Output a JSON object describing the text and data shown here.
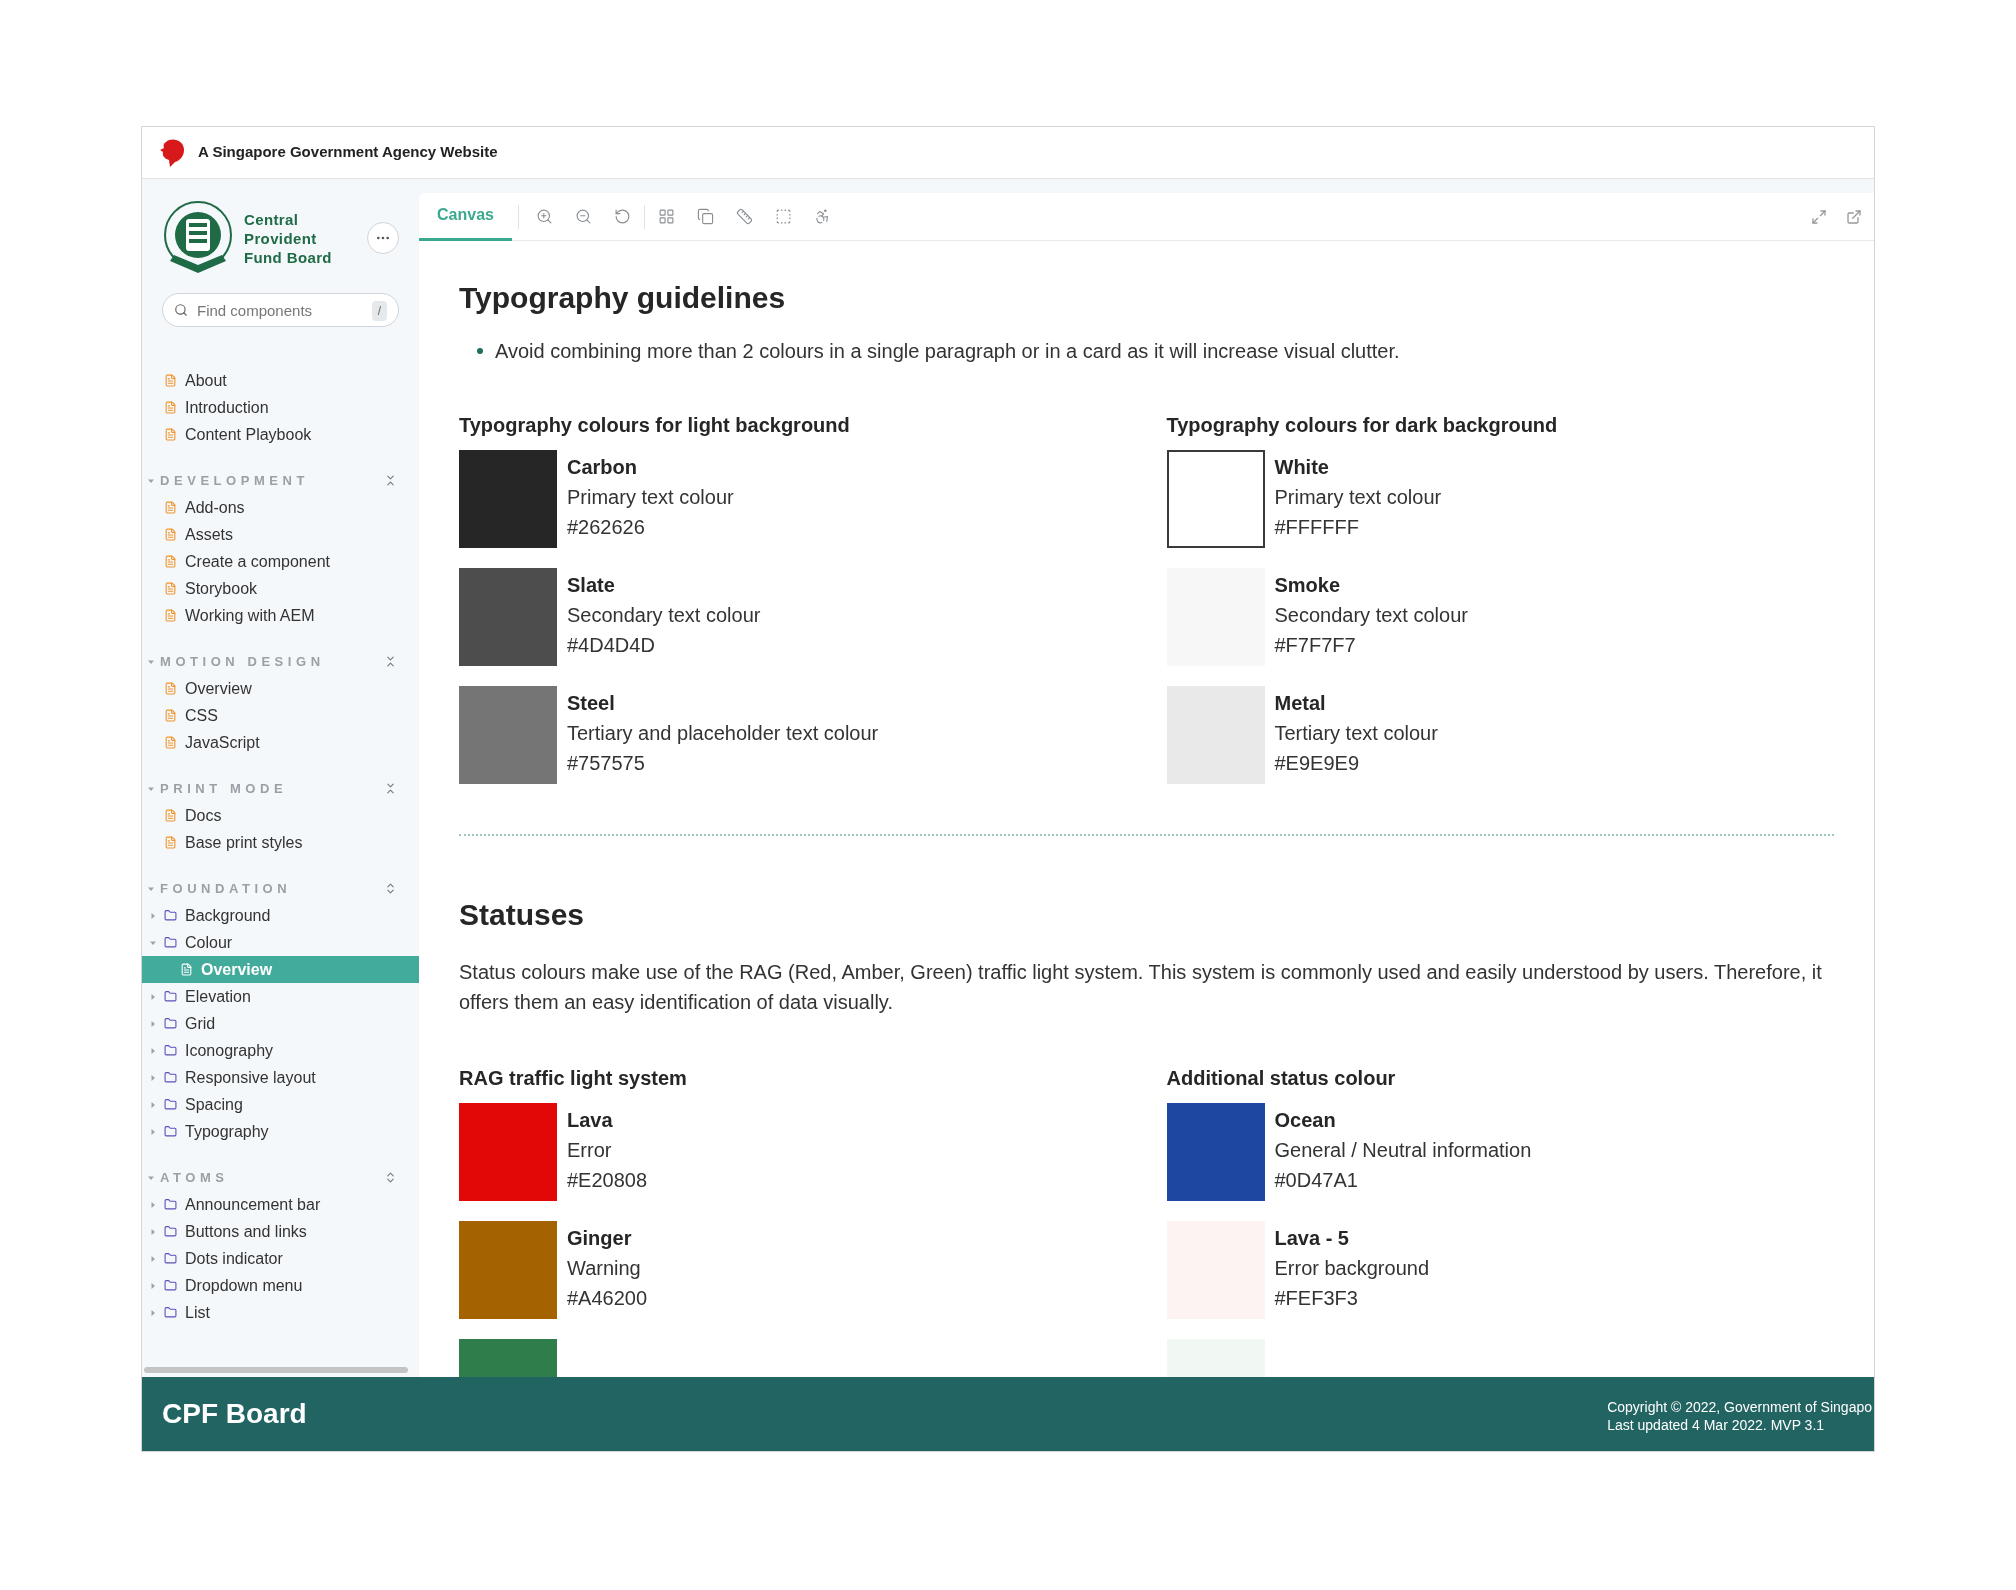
{
  "masthead": {
    "text": "A Singapore Government Agency Website"
  },
  "sidebar": {
    "logo_text": [
      "Central",
      "Provident",
      "Fund Board"
    ],
    "search": {
      "placeholder": "Find components",
      "shortcut": "/"
    },
    "top_items": [
      {
        "label": "About",
        "kind": "page",
        "selected": false
      },
      {
        "label": "Introduction",
        "kind": "page",
        "selected": false
      },
      {
        "label": "Content Playbook",
        "kind": "page",
        "selected": false
      }
    ],
    "sections": [
      {
        "title": "DEVELOPMENT",
        "all_expanded": true,
        "items": [
          {
            "label": "Add-ons",
            "kind": "page",
            "selected": false
          },
          {
            "label": "Assets",
            "kind": "page",
            "selected": false
          },
          {
            "label": "Create a component",
            "kind": "page",
            "selected": false
          },
          {
            "label": "Storybook",
            "kind": "page",
            "selected": false
          },
          {
            "label": "Working with AEM",
            "kind": "page",
            "selected": false
          }
        ]
      },
      {
        "title": "MOTION DESIGN",
        "all_expanded": true,
        "items": [
          {
            "label": "Overview",
            "kind": "page",
            "selected": false
          },
          {
            "label": "CSS",
            "kind": "page",
            "selected": false
          },
          {
            "label": "JavaScript",
            "kind": "page",
            "selected": false
          }
        ]
      },
      {
        "title": "PRINT MODE",
        "all_expanded": true,
        "items": [
          {
            "label": "Docs",
            "kind": "page",
            "selected": false
          },
          {
            "label": "Base print styles",
            "kind": "page",
            "selected": false
          }
        ]
      },
      {
        "title": "FOUNDATION",
        "all_expanded": false,
        "items": [
          {
            "label": "Background",
            "kind": "folder",
            "expanded": false,
            "selected": false
          },
          {
            "label": "Colour",
            "kind": "folder",
            "expanded": true,
            "selected": false,
            "children": [
              {
                "label": "Overview",
                "kind": "page",
                "selected": true
              }
            ]
          },
          {
            "label": "Elevation",
            "kind": "folder",
            "expanded": false,
            "selected": false
          },
          {
            "label": "Grid",
            "kind": "folder",
            "expanded": false,
            "selected": false
          },
          {
            "label": "Iconography",
            "kind": "folder",
            "expanded": false,
            "selected": false
          },
          {
            "label": "Responsive layout",
            "kind": "folder",
            "expanded": false,
            "selected": false
          },
          {
            "label": "Spacing",
            "kind": "folder",
            "expanded": false,
            "selected": false
          },
          {
            "label": "Typography",
            "kind": "folder",
            "expanded": false,
            "selected": false
          }
        ]
      },
      {
        "title": "ATOMS",
        "all_expanded": false,
        "items": [
          {
            "label": "Announcement bar",
            "kind": "folder",
            "expanded": false,
            "selected": false
          },
          {
            "label": "Buttons and links",
            "kind": "folder",
            "expanded": false,
            "selected": false
          },
          {
            "label": "Dots indicator",
            "kind": "folder",
            "expanded": false,
            "selected": false
          },
          {
            "label": "Dropdown menu",
            "kind": "folder",
            "expanded": false,
            "selected": false
          },
          {
            "label": "List",
            "kind": "folder",
            "expanded": false,
            "selected": false
          }
        ]
      }
    ]
  },
  "toolbar": {
    "tabs": [
      {
        "label": "Canvas",
        "selected": true
      }
    ]
  },
  "typography": {
    "title": "Typography guidelines",
    "bullets": [
      "Avoid combining more than 2 colours in a single paragraph or in a card as it will increase visual clutter."
    ],
    "columns": [
      {
        "heading": "Typography colours for light background",
        "swatches": [
          {
            "name": "Carbon",
            "role": "Primary text colour",
            "hex": "#262626",
            "color": "#262626",
            "outlined": false
          },
          {
            "name": "Slate",
            "role": "Secondary text colour",
            "hex": "#4D4D4D",
            "color": "#4d4d4d",
            "outlined": false
          },
          {
            "name": "Steel",
            "role": "Tertiary and placeholder text colour",
            "hex": "#757575",
            "color": "#757575",
            "outlined": false
          }
        ]
      },
      {
        "heading": "Typography colours for dark background",
        "swatches": [
          {
            "name": "White",
            "role": "Primary text colour",
            "hex": "#FFFFFF",
            "color": "#ffffff",
            "outlined": true
          },
          {
            "name": "Smoke",
            "role": "Secondary text colour",
            "hex": "#F7F7F7",
            "color": "#f7f7f7",
            "outlined": false
          },
          {
            "name": "Metal",
            "role": "Tertiary text colour",
            "hex": "#E9E9E9",
            "color": "#e9e9e9",
            "outlined": false
          }
        ]
      }
    ]
  },
  "statuses": {
    "title": "Statuses",
    "paragraph": "Status colours make use of the RAG (Red, Amber, Green) traffic light system. This system is commonly used and easily understood by users. Therefore, it offers them an easy identification of data visually.",
    "columns": [
      {
        "heading": "RAG traffic light system",
        "swatches": [
          {
            "name": "Lava",
            "role": "Error",
            "hex": "#E20808",
            "color": "#e20808",
            "outlined": false
          },
          {
            "name": "Ginger",
            "role": "Warning",
            "hex": "#A46200",
            "color": "#a46200",
            "outlined": false
          },
          {
            "color": "#2e7d4a",
            "outlined": false
          }
        ]
      },
      {
        "heading": "Additional status colour",
        "swatches": [
          {
            "name": "Ocean",
            "role": "General / Neutral information",
            "hex": "#0D47A1",
            "color": "#1d47a1",
            "outlined": false
          },
          {
            "name": "Lava - 5",
            "role": "Error background",
            "hex": "#FEF3F3",
            "color": "#fef3f3",
            "outlined": false
          },
          {
            "color": "#f1f8f4",
            "outlined": false
          }
        ]
      }
    ]
  },
  "footer": {
    "brand": "CPF Board",
    "lines": [
      "Copyright © 2022, Government of Singapo",
      "Last updated 4 Mar 2022. MVP 3.1"
    ]
  }
}
